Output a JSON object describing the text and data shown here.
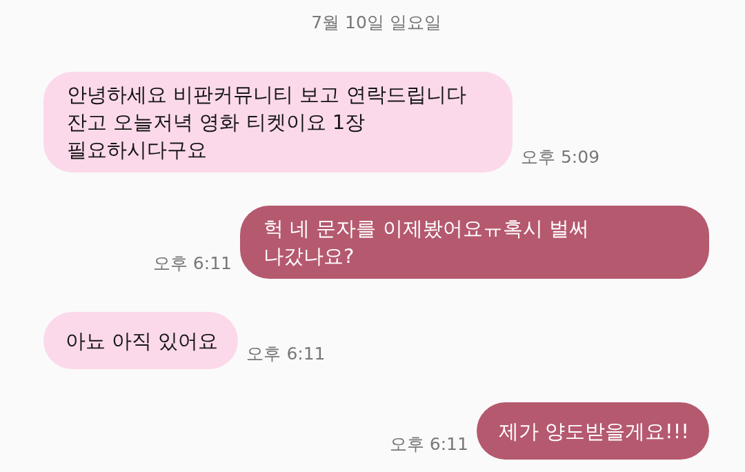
{
  "date_header": "7월 10일 일요일",
  "messages": [
    {
      "kind": "received",
      "text": "안녕하세요 비판커뮤니티 보고 연락드립니다\n잔고 오늘저녁 영화 티켓이요 1장\n필요하시다구요",
      "time": "오후 5:09"
    },
    {
      "kind": "sent",
      "text": "헉 네 문자를 이제봤어요ㅠ혹시 벌써\n나갔나요?",
      "time": "오후 6:11"
    },
    {
      "kind": "received",
      "text": "아뇨 아직 있어요",
      "time": "오후 6:11"
    },
    {
      "kind": "sent",
      "text": "제가 양도받을게요!!!",
      "time": "오후 6:11"
    }
  ]
}
